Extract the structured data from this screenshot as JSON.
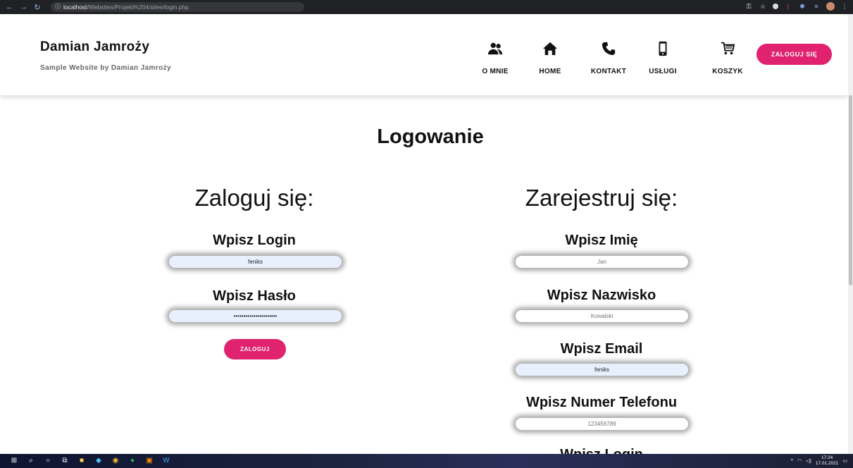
{
  "browser": {
    "url_host": "localhost",
    "url_path": "/Websites/Projekt%204/sites/login.php"
  },
  "header": {
    "title": "Damian Jamroży",
    "subtitle": "Sample Website by Damian Jamroży",
    "nav": [
      {
        "label": "O MNIE",
        "icon": "users-icon"
      },
      {
        "label": "HOME",
        "icon": "home-icon"
      },
      {
        "label": "KONTAKT",
        "icon": "phone-icon"
      },
      {
        "label": "USŁUGI",
        "icon": "mobile-phone-icon"
      },
      {
        "label": "KOSZYK",
        "icon": "cart-icon"
      }
    ],
    "login_button": "ZALOGUJ SIĘ"
  },
  "main": {
    "title": "Logowanie",
    "login": {
      "heading": "Zaloguj się:",
      "login_label": "Wpisz Login",
      "login_value": "feniks",
      "password_label": "Wpisz Hasło",
      "password_value": "••••••••••••••••••••••",
      "submit": "ZALOGUJ"
    },
    "register": {
      "heading": "Zarejestruj się:",
      "name_label": "Wpisz Imię",
      "name_placeholder": "Jan",
      "surname_label": "Wpisz Nazwisko",
      "surname_placeholder": "Kowalski",
      "email_label": "Wpisz Email",
      "email_value": "feniks",
      "phone_label": "Wpisz Numer Telefonu",
      "phone_placeholder": "123456789",
      "login_label": "Wpisz Login"
    }
  },
  "taskbar": {
    "time": "17:24",
    "date": "17.01.2021"
  },
  "colors": {
    "accent": "#e0226f",
    "autofill": "#e8f0fe"
  }
}
